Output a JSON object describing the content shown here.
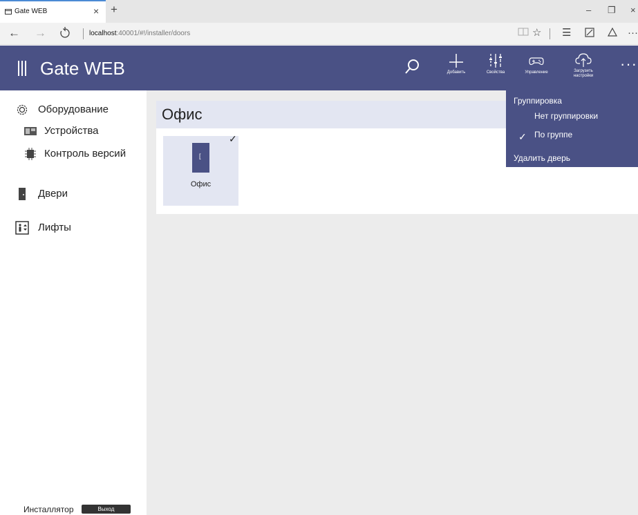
{
  "browser": {
    "tab_title": "Gate WEB",
    "tab_close": "×",
    "new_tab": "+",
    "url_host": "localhost",
    "url_rest": ":40001/#!/installer/doors",
    "window_minimize": "–",
    "window_maximize": "❐",
    "window_close": "×",
    "more": "···"
  },
  "app": {
    "title": "Gate WEB",
    "header_color": "#4a5185",
    "toolbar": {
      "add_label": "Добавить",
      "properties_label": "Свойства",
      "control_label": "Управление",
      "upload_label": "Загрузить настройки",
      "more": "···"
    }
  },
  "sidebar": {
    "equipment": "Оборудование",
    "devices": "Устройства",
    "version_control": "Контроль версий",
    "doors": "Двери",
    "elevators": "Лифты",
    "role": "Инсталлятор",
    "logout": "Выход"
  },
  "main": {
    "group_title": "Офис",
    "doors": [
      {
        "label": "Офис",
        "selected": true
      }
    ]
  },
  "dropdown": {
    "grouping_header": "Группировка",
    "no_grouping": "Нет группировки",
    "by_group": "По группе",
    "by_group_checked": true,
    "delete_door": "Удалить дверь"
  }
}
